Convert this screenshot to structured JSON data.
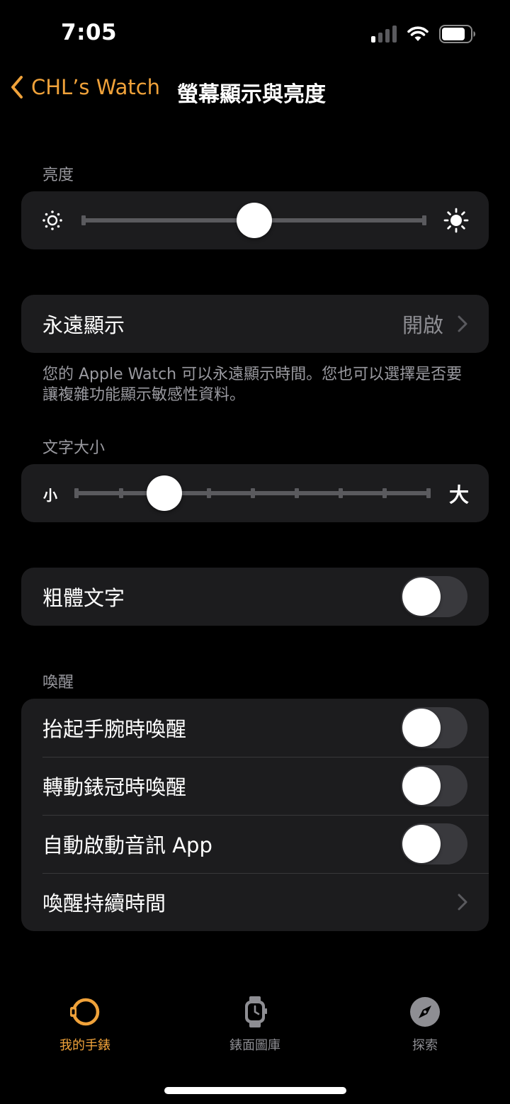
{
  "status_bar": {
    "time": "7:05"
  },
  "nav": {
    "back_label": "CHL’s Watch",
    "title": "螢幕顯示與亮度"
  },
  "brightness": {
    "header": "亮度",
    "value": 0.5
  },
  "always_on": {
    "label": "永遠顯示",
    "value": "開啟"
  },
  "always_on_footnote": "您的 Apple Watch 可以永遠顯示時間。您也可以選擇是否要讓複雜功能顯示敏感性資料。",
  "text_size": {
    "header": "文字大小",
    "small_label": "小",
    "large_label": "大",
    "value": 0.25
  },
  "bold_text": {
    "label": "粗體文字",
    "on": false
  },
  "wake": {
    "header": "喚醒",
    "items": [
      {
        "label": "抬起手腕時喚醒",
        "on": false
      },
      {
        "label": "轉動錶冠時喚醒",
        "on": false
      },
      {
        "label": "自動啟動音訊 App",
        "on": false
      },
      {
        "label": "喚醒持續時間"
      }
    ]
  },
  "tabbar": {
    "tabs": [
      {
        "label": "我的手錶",
        "icon": "watch-icon"
      },
      {
        "label": "錶面圖庫",
        "icon": "watch-face-icon"
      },
      {
        "label": "探索",
        "icon": "compass-icon"
      }
    ]
  },
  "colors": {
    "accent": "#f0a23a",
    "card": "#1c1c1e",
    "background": "#000000"
  }
}
